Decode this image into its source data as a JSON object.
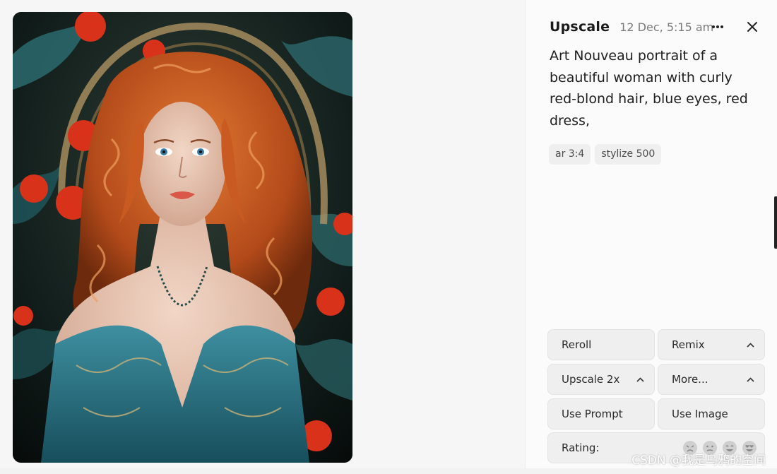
{
  "header": {
    "title": "Upscale",
    "timestamp": "12 Dec, 5:15 am"
  },
  "prompt": {
    "text": "Art Nouveau portrait of a beautiful woman with curly red-blond hair, blue eyes, red dress,"
  },
  "params": [
    {
      "label": "ar 3:4"
    },
    {
      "label": "stylize 500"
    }
  ],
  "actions": {
    "reroll": "Reroll",
    "remix": "Remix",
    "upscale": "Upscale 2x",
    "more": "More...",
    "use_prompt": "Use Prompt",
    "use_image": "Use Image",
    "rating_label": "Rating:"
  },
  "icons": {
    "more": "more-horizontal-icon",
    "close": "close-icon",
    "chevron": "chevron-up-icon",
    "ratings": [
      "rating-awful-icon",
      "rating-meh-icon",
      "rating-good-icon",
      "rating-love-icon"
    ]
  },
  "watermark": "CSDN @我是乌鸦的空间",
  "colors": {
    "hair": "#c1531f",
    "dress": "#2b7a8c",
    "background": "#0e1716"
  }
}
